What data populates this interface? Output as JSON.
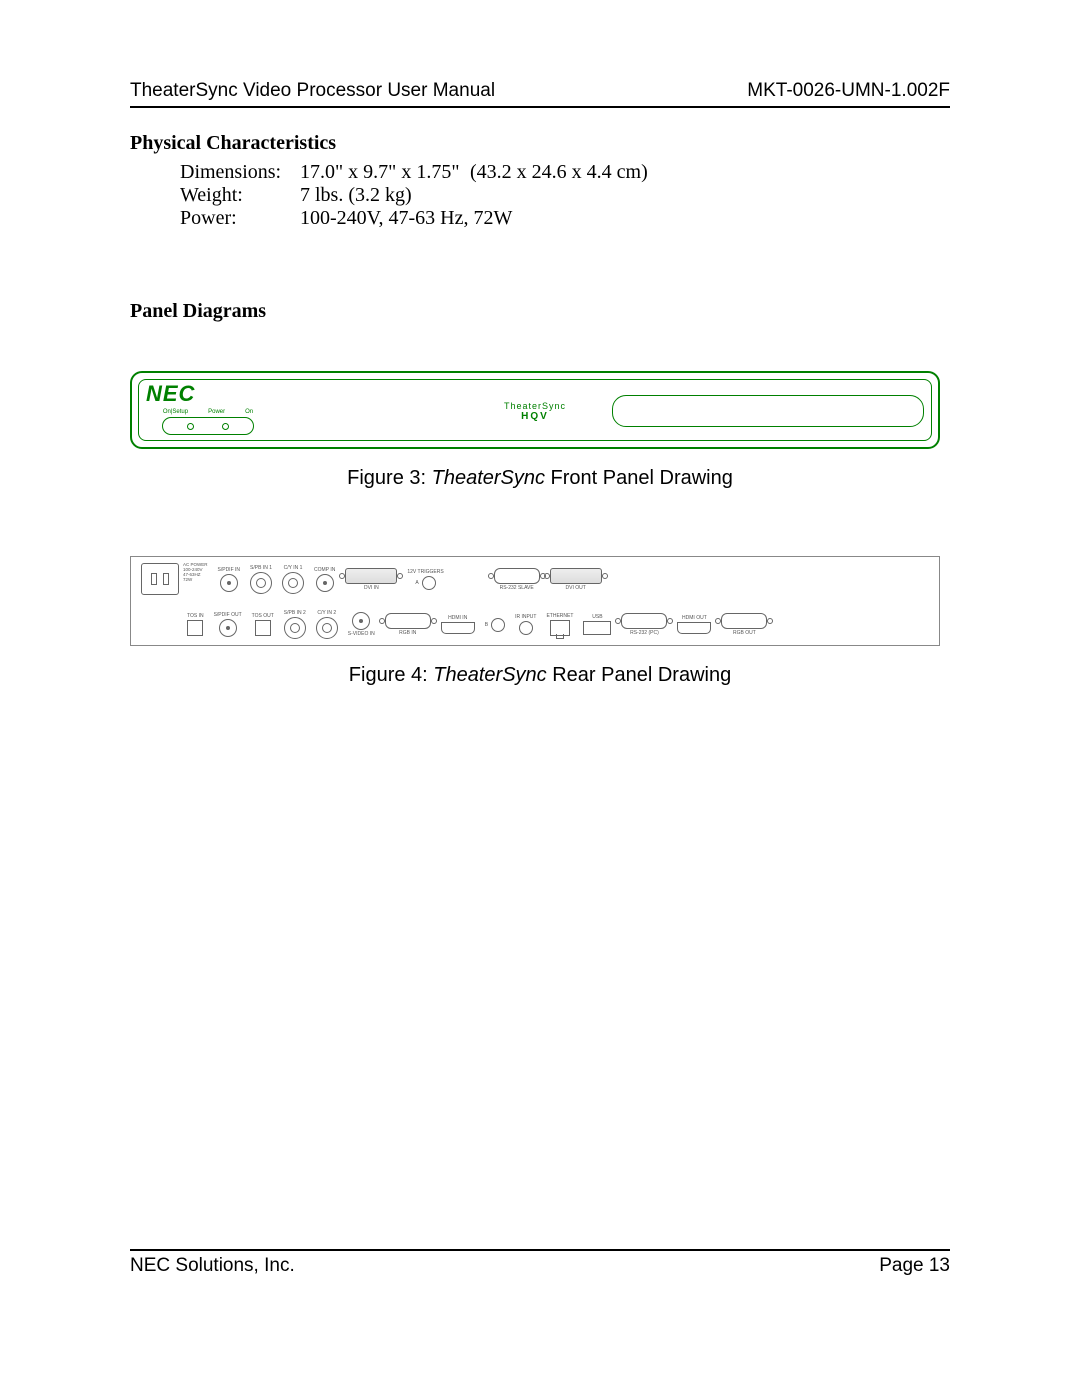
{
  "header": {
    "left": "TheaterSync Video Processor User Manual",
    "right": "MKT-0026-UMN-1.002F"
  },
  "sections": {
    "phys_char": "Physical Characteristics",
    "panel_diag": "Panel Diagrams"
  },
  "specs": {
    "dimensions_label": "Dimensions:",
    "dimensions_imperial": "17.0\" x 9.7\" x 1.75\"",
    "dimensions_metric": "(43.2 x 24.6 x 4.4 cm)",
    "weight_label": "Weight:",
    "weight_val": "7 lbs.  (3.2 kg)",
    "power_label": "Power:",
    "power_val": "100-240V, 47-63 Hz, 72W"
  },
  "front_panel": {
    "logo": "NEC",
    "labels": {
      "on_setup": "On|Setup",
      "power": "Power",
      "on": "On"
    },
    "center1": "TheaterSync",
    "center2": "HQV"
  },
  "captions": {
    "fig3_prefix": "Figure 3: ",
    "fig3_italic": "TheaterSync",
    "fig3_suffix": " Front Panel Drawing",
    "fig4_prefix": "Figure 4: ",
    "fig4_italic": "TheaterSync",
    "fig4_suffix": " Rear Panel Drawing"
  },
  "rear_panel": {
    "ac_power": "AC POWER",
    "ac_spec1": "100-240V",
    "ac_spec2": "47-63HZ",
    "ac_spec3": "72W",
    "spdif_in": "S/PDIF IN",
    "spdif_out": "S/PDIF OUT",
    "tos_in": "TOS IN",
    "tos_out": "TOS OUT",
    "spb_in_1": "S/PB IN 1",
    "spb_in_2": "S/PB IN 2",
    "cy_in_1": "C/Y IN 1",
    "cy_in_2": "C/Y IN 2",
    "svideo_in": "S-VIDEO IN",
    "comp_in": "COMP IN",
    "dvi_in": "DVI IN",
    "rgb_in": "RGB IN",
    "hdmi_in": "HDMI IN",
    "triggers": "12V TRIGGERS",
    "trigger_a": "A",
    "trigger_b": "B",
    "ir_input": "IR INPUT",
    "ethernet": "ETHERNET",
    "usb": "USB",
    "rs232_slave": "RS-232 SLAVE",
    "rs232_pc": "RS-232 (PC)",
    "dvi_out": "DVI OUT",
    "hdmi_out": "HDMI OUT",
    "rgb_out": "RGB OUT"
  },
  "footer": {
    "left": "NEC Solutions, Inc.",
    "right": "Page 13"
  }
}
